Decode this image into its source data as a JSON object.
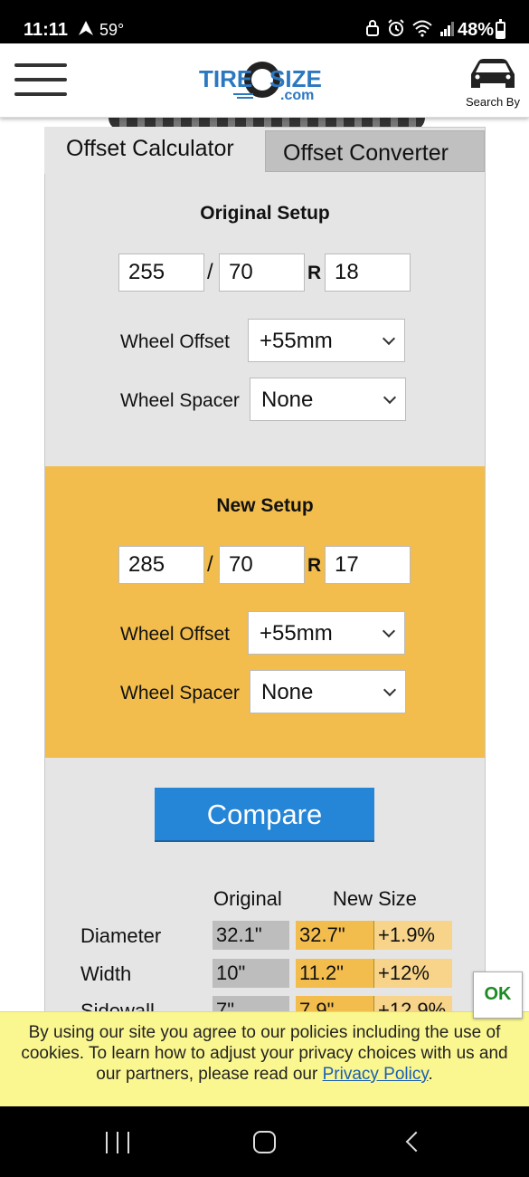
{
  "status_bar": {
    "time": "11:11",
    "temperature": "59°",
    "battery": "48%",
    "battery_level": 0.48
  },
  "header": {
    "search_label": "Search By"
  },
  "tabs": [
    {
      "label": "Offset Calculator",
      "active": true
    },
    {
      "label": "Offset Converter",
      "active": false
    }
  ],
  "original": {
    "title": "Original Setup",
    "width": "255",
    "aspect": "70",
    "sep_slash": "/",
    "sep_r": "R",
    "rim": "18",
    "offset_label": "Wheel Offset",
    "offset_value": "+55mm",
    "spacer_label": "Wheel Spacer",
    "spacer_value": "None"
  },
  "new": {
    "title": "New Setup",
    "width": "285",
    "aspect": "70",
    "sep_slash": "/",
    "sep_r": "R",
    "rim": "17",
    "offset_label": "Wheel Offset",
    "offset_value": "+55mm",
    "spacer_label": "Wheel Spacer",
    "spacer_value": "None"
  },
  "compare_label": "Compare",
  "results": {
    "headers": {
      "original": "Original",
      "new_size": "New Size"
    },
    "rows": [
      {
        "label": "Diameter",
        "original": "32.1\"",
        "new": "32.7\"",
        "diff": "+1.9%"
      },
      {
        "label": "Width",
        "original": "10\"",
        "new": "11.2\"",
        "diff": "+12%"
      },
      {
        "label": "Sidewall",
        "original": "7\"",
        "new": "7.9\"",
        "diff": "+12.9%"
      }
    ]
  },
  "cookie": {
    "text": "By using our site you agree to our policies including the use of cookies. To learn how to adjust your privacy choices with us and our partners, please read our ",
    "link": "Privacy Policy",
    "end": ".",
    "ok_label": "OK"
  },
  "colors": {
    "accent_blue": "#2585d6",
    "new_setup_bg": "#f2bd4d",
    "cookie_bg": "#fbf790",
    "ok_green": "#1c8a25"
  },
  "icons": [
    "navigation-arrow-icon",
    "lock-icon",
    "alarm-icon",
    "wifi-icon",
    "signal-icon",
    "battery-icon",
    "menu-icon",
    "car-icon",
    "chevron-down-icon",
    "recent-apps-icon",
    "home-icon",
    "back-icon"
  ]
}
